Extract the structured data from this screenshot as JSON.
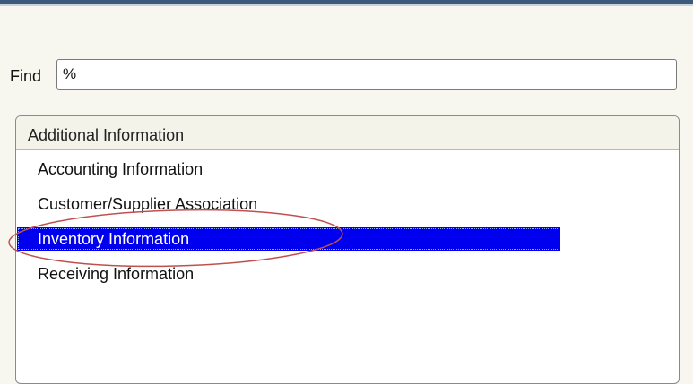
{
  "find": {
    "label": "Find",
    "value": "%"
  },
  "list": {
    "header": "Additional Information",
    "items": [
      {
        "label": "Accounting Information",
        "selected": false
      },
      {
        "label": "Customer/Supplier Association",
        "selected": false
      },
      {
        "label": "Inventory Information",
        "selected": true
      },
      {
        "label": "Receiving Information",
        "selected": false
      }
    ]
  },
  "colors": {
    "selection": "#0000ee",
    "annotation": "#c0504d",
    "window_border": "#3c5a7a"
  }
}
